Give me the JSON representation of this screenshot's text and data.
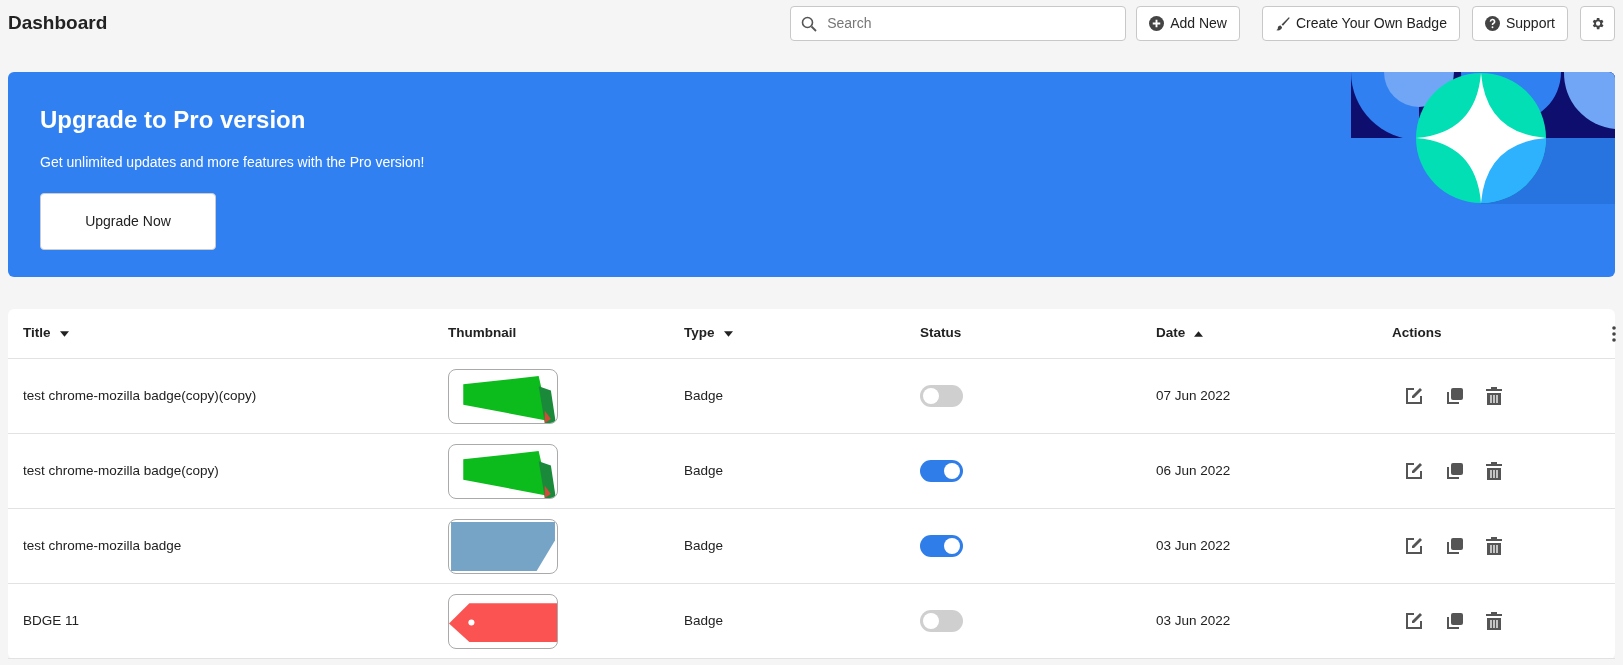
{
  "header": {
    "title": "Dashboard",
    "search": {
      "placeholder": "Search"
    },
    "buttons": [
      {
        "label": "Add New",
        "kind": "add"
      },
      {
        "label": "Create Your Own Badge",
        "kind": "brush"
      },
      {
        "label": "Support",
        "kind": "help"
      }
    ]
  },
  "banner": {
    "title": "Upgrade to Pro version",
    "text": "Get unlimited updates and more features with the Pro version!",
    "button": "Upgrade Now"
  },
  "table": {
    "columns": [
      {
        "label": "Title",
        "kind": "sort-desc"
      },
      {
        "label": "Thumbnail",
        "kind": "plain"
      },
      {
        "label": "Type",
        "kind": "sort-desc"
      },
      {
        "label": "Status",
        "kind": "plain"
      },
      {
        "label": "Date",
        "kind": "sort-asc"
      },
      {
        "label": "Actions",
        "kind": "plain"
      }
    ],
    "rows": [
      {
        "title": "test chrome-mozilla badge(copy)(copy)",
        "thumbnail": {
          "kind": "sale"
        },
        "type": "Badge",
        "on": false,
        "date": "07 Jun 2022"
      },
      {
        "title": "test chrome-mozilla badge(copy)",
        "thumbnail": {
          "kind": "sale"
        },
        "type": "Badge",
        "on": true,
        "date": "06 Jun 2022"
      },
      {
        "title": "test chrome-mozilla badge",
        "thumbnail": {
          "kind": "blue-tag"
        },
        "type": "Badge",
        "on": true,
        "date": "03 Jun 2022"
      },
      {
        "title": "BDGE 11",
        "thumbnail": {
          "kind": "red-tag"
        },
        "type": "Badge",
        "on": false,
        "date": "03 Jun 2022"
      }
    ]
  }
}
